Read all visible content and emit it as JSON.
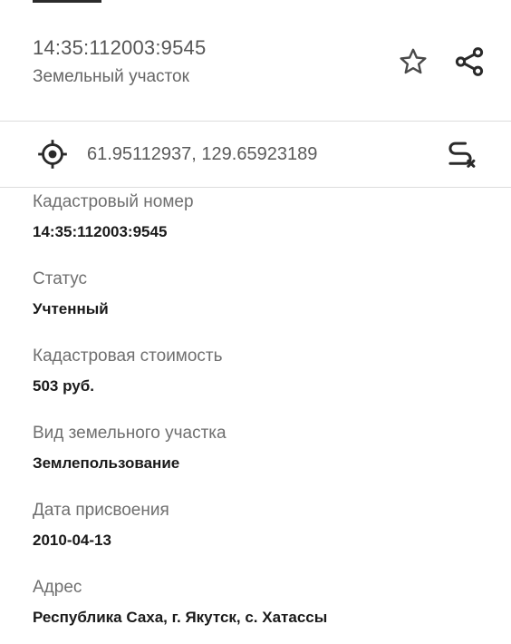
{
  "header": {
    "title": "14:35:112003:9545",
    "subtitle": "Земельный участок",
    "star_icon": "star-outline-icon",
    "share_icon": "share-icon"
  },
  "location": {
    "coordinates": "61.95112937, 129.65923189",
    "target_icon": "gps-target-icon",
    "route_icon": "route-clear-icon"
  },
  "fields": [
    {
      "label": "Кадастровый номер",
      "value": "14:35:112003:9545"
    },
    {
      "label": "Статус",
      "value": "Учтенный"
    },
    {
      "label": "Кадастровая стоимость",
      "value": "503 руб."
    },
    {
      "label": "Вид земельного участка",
      "value": "Землепользование"
    },
    {
      "label": "Дата присвоения",
      "value": "2010-04-13"
    },
    {
      "label": "Адрес",
      "value": "Республика Саха, г. Якутск, с. Хатассы"
    }
  ]
}
